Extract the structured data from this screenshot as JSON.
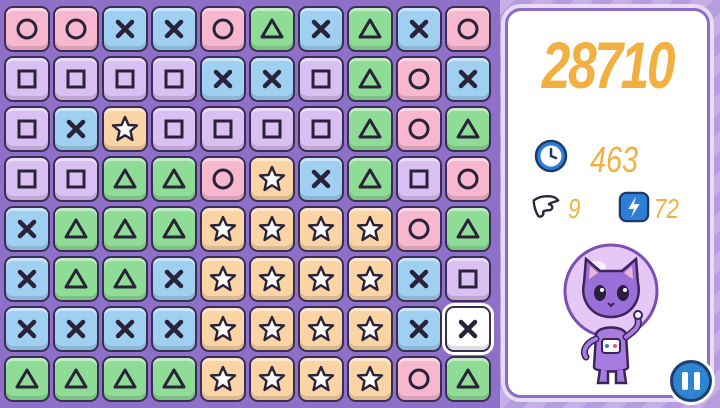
{
  "game": {
    "score": "28710",
    "timer": "463",
    "wings": "9",
    "bolts": "72"
  },
  "colors": {
    "pink": "#f7b7cf",
    "purple": "#d9bff2",
    "blue": "#9fd0f2",
    "green": "#8fdc97",
    "orange": "#fbd4a6",
    "score": "#f3b042"
  },
  "icons": {
    "timer": "clock-icon",
    "wings": "wing-icon",
    "bolts": "lightning-icon",
    "pause": "pause-icon"
  },
  "grid": [
    [
      "circle-pink",
      "circle-pink",
      "x-blue",
      "x-blue",
      "circle-pink",
      "triangle-green",
      "x-blue",
      "triangle-green",
      "x-blue",
      "circle-pink"
    ],
    [
      "square-purple",
      "square-purple",
      "square-purple",
      "square-purple",
      "x-blue",
      "x-blue",
      "square-purple",
      "triangle-green",
      "circle-pink",
      "x-blue"
    ],
    [
      "square-purple",
      "x-blue",
      "star-orange",
      "square-purple",
      "square-purple",
      "square-purple",
      "square-purple",
      "triangle-green",
      "circle-pink",
      "triangle-green"
    ],
    [
      "square-purple",
      "square-purple",
      "triangle-green",
      "triangle-green",
      "circle-pink",
      "star-orange",
      "x-blue",
      "triangle-green",
      "square-purple",
      "circle-pink"
    ],
    [
      "x-blue",
      "triangle-green",
      "triangle-green",
      "triangle-green",
      "star-orange",
      "star-orange",
      "star-orange",
      "star-orange",
      "circle-pink",
      "triangle-green"
    ],
    [
      "x-blue",
      "triangle-green",
      "triangle-green",
      "x-blue",
      "star-orange",
      "star-orange",
      "star-orange",
      "star-orange",
      "x-blue",
      "square-purple"
    ],
    [
      "x-blue",
      "x-blue",
      "x-blue",
      "x-blue",
      "star-orange",
      "star-orange",
      "star-orange",
      "star-orange",
      "x-blue",
      "x-white-selected"
    ],
    [
      "triangle-green",
      "triangle-green",
      "triangle-green",
      "triangle-green",
      "star-orange",
      "star-orange",
      "star-orange",
      "star-orange",
      "circle-pink",
      "triangle-green"
    ]
  ]
}
